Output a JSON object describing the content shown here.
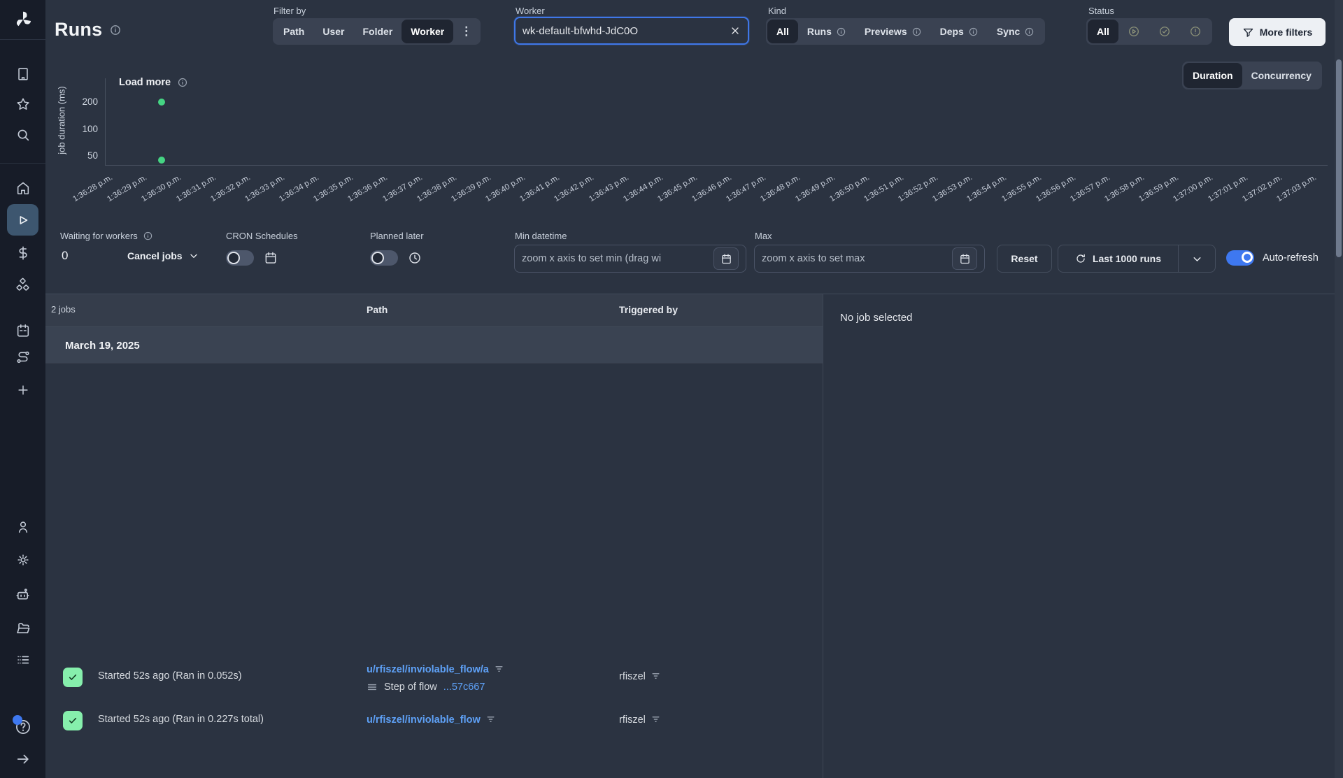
{
  "header": {
    "title": "Runs",
    "filter_by": {
      "label": "Filter by",
      "tabs": [
        "Path",
        "User",
        "Folder",
        "Worker"
      ],
      "selected": "Worker",
      "overflow_menu": "⋮"
    },
    "worker_input": {
      "label": "Worker",
      "value": "wk-default-bfwhd-JdC0O"
    },
    "kind": {
      "label": "Kind",
      "tabs": [
        "All",
        "Runs",
        "Previews",
        "Deps",
        "Sync"
      ],
      "selected": "All"
    },
    "status": {
      "label": "Status",
      "all_label": "All",
      "icons": [
        "running-circle",
        "success-circle",
        "failure-circle"
      ]
    },
    "more_filters_label": "More filters"
  },
  "view_toggle": {
    "options": [
      "Duration",
      "Concurrency"
    ],
    "selected": "Duration"
  },
  "load_more_label": "Load more",
  "chart_data": {
    "type": "scatter",
    "ylabel": "job duration (ms)",
    "y_scale": "log",
    "y_ticks": [
      "200",
      "100",
      "50"
    ],
    "point_color": "#45d483",
    "x_labels": [
      "1:36:28 p.m.",
      "1:36:29 p.m.",
      "1:36:30 p.m.",
      "1:36:31 p.m.",
      "1:36:32 p.m.",
      "1:36:33 p.m.",
      "1:36:34 p.m.",
      "1:36:35 p.m.",
      "1:36:36 p.m.",
      "1:36:37 p.m.",
      "1:36:38 p.m.",
      "1:36:39 p.m.",
      "1:36:40 p.m.",
      "1:36:41 p.m.",
      "1:36:42 p.m.",
      "1:36:43 p.m.",
      "1:36:44 p.m.",
      "1:36:45 p.m.",
      "1:36:46 p.m.",
      "1:36:47 p.m.",
      "1:36:48 p.m.",
      "1:36:49 p.m.",
      "1:36:50 p.m.",
      "1:36:51 p.m.",
      "1:36:52 p.m.",
      "1:36:53 p.m.",
      "1:36:54 p.m.",
      "1:36:55 p.m.",
      "1:36:56 p.m.",
      "1:36:57 p.m.",
      "1:36:58 p.m.",
      "1:36:59 p.m.",
      "1:37:00 p.m.",
      "1:37:01 p.m.",
      "1:37:02 p.m.",
      "1:37:03 p.m."
    ],
    "points": [
      {
        "x": "1:36:30 p.m.",
        "duration_ms": 227
      },
      {
        "x": "1:36:30 p.m.",
        "duration_ms": 52
      }
    ]
  },
  "controls": {
    "waiting": {
      "label": "Waiting for workers",
      "count": "0",
      "cancel_label": "Cancel jobs"
    },
    "cron": {
      "label": "CRON Schedules"
    },
    "planned": {
      "label": "Planned later"
    },
    "min_datetime": {
      "label": "Min datetime",
      "placeholder": "zoom x axis to set min (drag wi"
    },
    "max_datetime": {
      "label": "Max",
      "placeholder": "zoom x axis to set max"
    },
    "reset_label": "Reset",
    "last_runs_label": "Last 1000 runs",
    "auto_refresh_label": "Auto-refresh"
  },
  "table": {
    "jobs_count": "2 jobs",
    "col_path": "Path",
    "col_triggered": "Triggered by",
    "date_header": "March 19, 2025",
    "rows": [
      {
        "status": "success",
        "started": "Started 52s ago (Ran in 0.052s)",
        "path": "u/rfiszel/inviolable_flow/a",
        "sub_prefix": "Step of flow ",
        "sub_link": "...57c667",
        "triggered_by": "rfiszel"
      },
      {
        "status": "success",
        "started": "Started 52s ago (Ran in 0.227s total)",
        "path": "u/rfiszel/inviolable_flow",
        "triggered_by": "rfiszel"
      }
    ]
  },
  "detail_panel": {
    "empty_text": "No job selected"
  },
  "sidebar_icons": [
    "windmill-logo",
    "workspace-icon",
    "favorites-icon",
    "search-icon",
    "home-icon",
    "runs-icon",
    "variables-icon",
    "resources-icon",
    "schedules-icon",
    "flows-icon",
    "add-icon",
    "user-icon",
    "settings-icon",
    "workers-icon",
    "folders-icon",
    "audit-logs-icon",
    "help-icon",
    "expand-icon"
  ],
  "colors": {
    "accent_blue": "#3e78f0",
    "success_green": "#86efac",
    "dot_green": "#45d483",
    "link_blue": "#5ea1f7"
  }
}
